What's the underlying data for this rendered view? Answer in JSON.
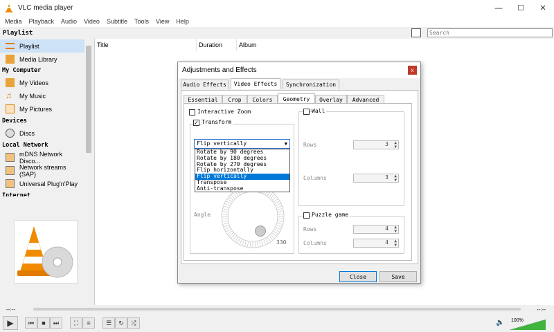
{
  "window": {
    "title": "VLC media player"
  },
  "menu": [
    "Media",
    "Playback",
    "Audio",
    "Video",
    "Subtitle",
    "Tools",
    "View",
    "Help"
  ],
  "playlist_header": "Playlist",
  "search": {
    "placeholder": "Search"
  },
  "sidebar": {
    "sections": {
      "my_computer": "My Computer",
      "devices": "Devices",
      "local_network": "Local Network",
      "internet": "Internet"
    },
    "items": {
      "playlist": "Playlist",
      "media_library": "Media Library",
      "my_videos": "My Videos",
      "my_music": "My Music",
      "my_pictures": "My Pictures",
      "discs": "Discs",
      "mdns": "mDNS Network Disco...",
      "network_streams": "Network streams (SAP)",
      "upnp": "Universal Plug'n'Play"
    }
  },
  "columns": {
    "title": "Title",
    "duration": "Duration",
    "album": "Album"
  },
  "time": {
    "elapsed": "--:--",
    "total": "--:--"
  },
  "volume": {
    "percent": "100%",
    "level": 1.0
  },
  "dialog": {
    "title": "Adjustments and Effects",
    "tabs": [
      "Audio Effects",
      "Video Effects",
      "Synchronization"
    ],
    "subtabs": [
      "Essential",
      "Crop",
      "Colors",
      "Geometry",
      "Overlay",
      "Advanced"
    ],
    "interactive_zoom": "Interactive Zoom",
    "transform": "Transform",
    "transform_value": "Flip vertically",
    "transform_options": [
      "Rotate by 90 degrees",
      "Rotate by 180 degrees",
      "Rotate by 270 degrees",
      "Flip horizontally",
      "Flip vertically",
      "Transpose",
      "Anti-transpose"
    ],
    "angle_label": "Angle",
    "angle_value": "330",
    "wall": "Wall",
    "rows_label": "Rows",
    "rows_value": "3",
    "columns_label": "Columns",
    "columns_value": "3",
    "puzzle": "Puzzle game",
    "puzzle_rows_value": "4",
    "puzzle_columns_value": "4",
    "close_label": "Close",
    "save_label": "Save"
  }
}
